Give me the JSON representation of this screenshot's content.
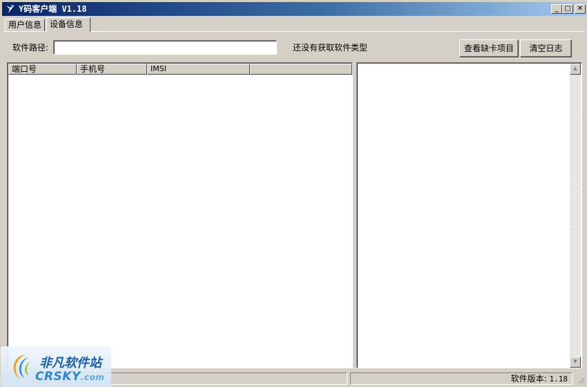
{
  "window": {
    "title": "Y码客户端  V1.18"
  },
  "titlebar_buttons": {
    "minimize": "_",
    "maximize": "□",
    "close": "✕"
  },
  "tabs": [
    {
      "label": "用户信息",
      "active": false
    },
    {
      "label": "设备信息",
      "active": true
    }
  ],
  "toolbar": {
    "path_label": "软件路径:",
    "path_value": "",
    "status_text": "还没有获取软件类型",
    "missing_button": "查看缺卡项目",
    "clear_button": "清空日志"
  },
  "port_table": {
    "columns": [
      "端口号",
      "手机号",
      "IMSI",
      ""
    ],
    "rows": []
  },
  "log": {
    "lines": []
  },
  "statusbar": {
    "version_label": "软件版本:",
    "version_value": "1.18"
  },
  "watermark": {
    "cn": "非凡软件站",
    "en_main": "CRSKY",
    "en_suffix": ".com"
  },
  "colors": {
    "titlebar_start": "#0a246a",
    "titlebar_end": "#a6caf0",
    "face": "#d4d0c8"
  },
  "icons": {
    "app": "app-icon",
    "scroll_up": "arrow-up-icon",
    "scroll_down": "arrow-down-icon"
  }
}
